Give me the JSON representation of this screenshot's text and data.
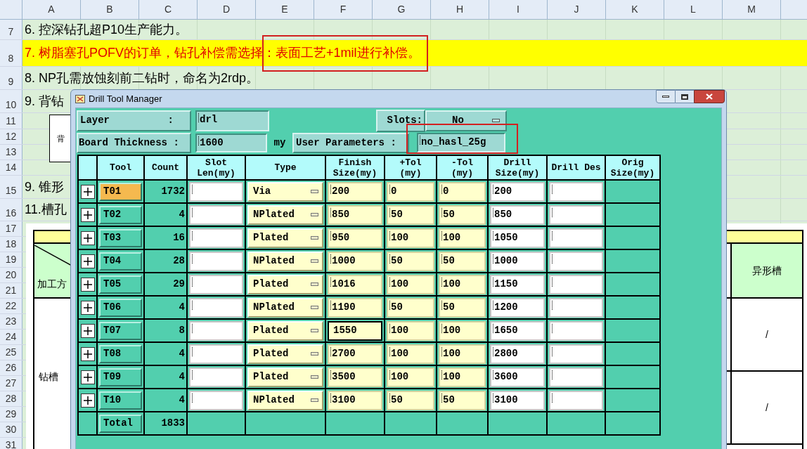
{
  "sheet": {
    "columns": [
      "A",
      "B",
      "C",
      "D",
      "E",
      "F",
      "G",
      "H",
      "I",
      "J",
      "K",
      "L",
      "M"
    ],
    "rows": [
      {
        "number": "7",
        "text": "6. 控深钻孔超P10生产能力。",
        "highlighted": false
      },
      {
        "number": "8",
        "text": "7. 树脂塞孔POFV的订单，钻孔补偿需选择：表面工艺+1mil进行补偿。",
        "highlighted": true
      },
      {
        "number": "9",
        "text": "8. NP孔需放蚀刻前二钻时，命名为2rdp。",
        "highlighted": false
      },
      {
        "number": "10",
        "text": "9. 背钻",
        "highlighted": false
      },
      {
        "number": "11"
      },
      {
        "number": "12"
      },
      {
        "number": "13"
      },
      {
        "number": "14"
      },
      {
        "number": "15",
        "text": "9. 锥形",
        "highlighted": false
      },
      {
        "number": "16",
        "text": "11.槽孔",
        "highlighted": false
      },
      {
        "number": "17"
      },
      {
        "number": "18"
      },
      {
        "number": "19"
      },
      {
        "number": "20"
      },
      {
        "number": "21"
      },
      {
        "number": "22"
      },
      {
        "number": "23"
      },
      {
        "number": "24"
      },
      {
        "number": "25"
      },
      {
        "number": "26"
      },
      {
        "number": "27"
      },
      {
        "number": "28"
      },
      {
        "number": "29"
      },
      {
        "number": "30"
      },
      {
        "number": "31"
      }
    ],
    "diagram_box": {
      "text": "背"
    },
    "lower_table": {
      "left_header": "加工方",
      "left_body": "钻槽",
      "right_header": "异形槽",
      "right_cells": [
        "/",
        "/"
      ]
    }
  },
  "dialog": {
    "title": "Drill Tool Manager",
    "layer": {
      "label": "Layer",
      "colon": ":",
      "value": "drl"
    },
    "slots": {
      "label": "Slots:",
      "value": "No"
    },
    "board_thickness": {
      "label": "Board Thickness :",
      "value": "1600",
      "unit": "my"
    },
    "user_parameters": {
      "label": "User Parameters :",
      "value": "no_hasl_25g"
    },
    "columns": [
      "Tool",
      "Count",
      "Slot Len(my)",
      "Type",
      "Finish Size(my)",
      "+Tol (my)",
      "-Tol (my)",
      "Drill Size(my)",
      "Drill Des",
      "Orig Size(my)"
    ],
    "rows": [
      {
        "tool": "T01",
        "selected": true,
        "count": "1732",
        "type": "Via",
        "finish": "200",
        "plus_tol": "0",
        "minus_tol": "0",
        "drill_size": "200",
        "focused": false
      },
      {
        "tool": "T02",
        "selected": false,
        "count": "4",
        "type": "NPlated",
        "finish": "850",
        "plus_tol": "50",
        "minus_tol": "50",
        "drill_size": "850",
        "focused": false
      },
      {
        "tool": "T03",
        "selected": false,
        "count": "16",
        "type": "Plated",
        "finish": "950",
        "plus_tol": "100",
        "minus_tol": "100",
        "drill_size": "1050",
        "focused": false
      },
      {
        "tool": "T04",
        "selected": false,
        "count": "28",
        "type": "NPlated",
        "finish": "1000",
        "plus_tol": "50",
        "minus_tol": "50",
        "drill_size": "1000",
        "focused": false
      },
      {
        "tool": "T05",
        "selected": false,
        "count": "29",
        "type": "Plated",
        "finish": "1016",
        "plus_tol": "100",
        "minus_tol": "100",
        "drill_size": "1150",
        "focused": false
      },
      {
        "tool": "T06",
        "selected": false,
        "count": "4",
        "type": "NPlated",
        "finish": "1190",
        "plus_tol": "50",
        "minus_tol": "50",
        "drill_size": "1200",
        "focused": false
      },
      {
        "tool": "T07",
        "selected": false,
        "count": "8",
        "type": "Plated",
        "finish": "1550",
        "plus_tol": "100",
        "minus_tol": "100",
        "drill_size": "1650",
        "focused": true
      },
      {
        "tool": "T08",
        "selected": false,
        "count": "4",
        "type": "Plated",
        "finish": "2700",
        "plus_tol": "100",
        "minus_tol": "100",
        "drill_size": "2800",
        "focused": false
      },
      {
        "tool": "T09",
        "selected": false,
        "count": "4",
        "type": "Plated",
        "finish": "3500",
        "plus_tol": "100",
        "minus_tol": "100",
        "drill_size": "3600",
        "focused": false
      },
      {
        "tool": "T10",
        "selected": false,
        "count": "4",
        "type": "NPlated",
        "finish": "3100",
        "plus_tol": "50",
        "minus_tol": "50",
        "drill_size": "3100",
        "focused": false
      }
    ],
    "total": {
      "label": "Total",
      "count": "1833"
    }
  }
}
